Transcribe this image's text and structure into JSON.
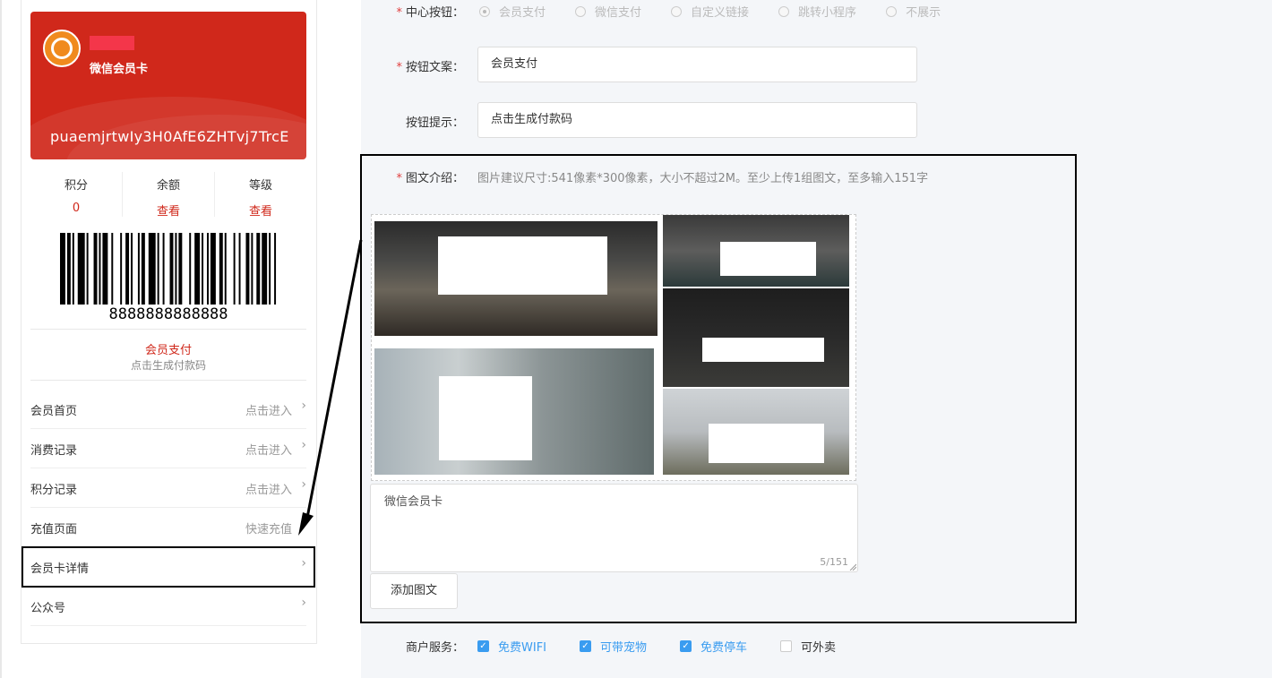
{
  "card": {
    "name": "微信会员卡",
    "code": "puaemjrtwIy3H0AfE6ZHTvj7TrcE",
    "brand_color": "#d0281b"
  },
  "stats": [
    {
      "label": "积分",
      "value": "0"
    },
    {
      "label": "余额",
      "value": "查看"
    },
    {
      "label": "等级",
      "value": "查看"
    }
  ],
  "barcode": {
    "number": "8888888888888"
  },
  "pay": {
    "title": "会员支付",
    "hint": "点击生成付款码"
  },
  "menu": [
    {
      "label": "会员首页",
      "right": "点击进入"
    },
    {
      "label": "消费记录",
      "right": "点击进入"
    },
    {
      "label": "积分记录",
      "right": "点击进入"
    },
    {
      "label": "充值页面",
      "right": "快速充值"
    },
    {
      "label": "会员卡详情",
      "right": ""
    },
    {
      "label": "公众号",
      "right": ""
    }
  ],
  "form": {
    "center_button": {
      "label": "中心按钮：",
      "options": [
        "会员支付",
        "微信支付",
        "自定义链接",
        "跳转小程序",
        "不展示"
      ],
      "selected": "会员支付"
    },
    "button_text": {
      "label": "按钮文案：",
      "value": "会员支付"
    },
    "button_hint": {
      "label": "按钮提示：",
      "value": "点击生成付款码"
    },
    "intro": {
      "label": "图文介绍：",
      "hint": "图片建议尺寸:541像素*300像素，大小不超过2M。至少上传1组图文，至多输入151字",
      "text": "微信会员卡",
      "counter": "5/151",
      "add_button": "添加图文"
    },
    "services": {
      "label": "商户服务：",
      "items": [
        {
          "label": "免费WIFI",
          "checked": true
        },
        {
          "label": "可带宠物",
          "checked": true
        },
        {
          "label": "免费停车",
          "checked": true
        },
        {
          "label": "可外卖",
          "checked": false
        }
      ]
    }
  },
  "colors": {
    "accent": "#3a9cf0",
    "required": "#e04040",
    "panel_bg": "#f4f6f9"
  }
}
